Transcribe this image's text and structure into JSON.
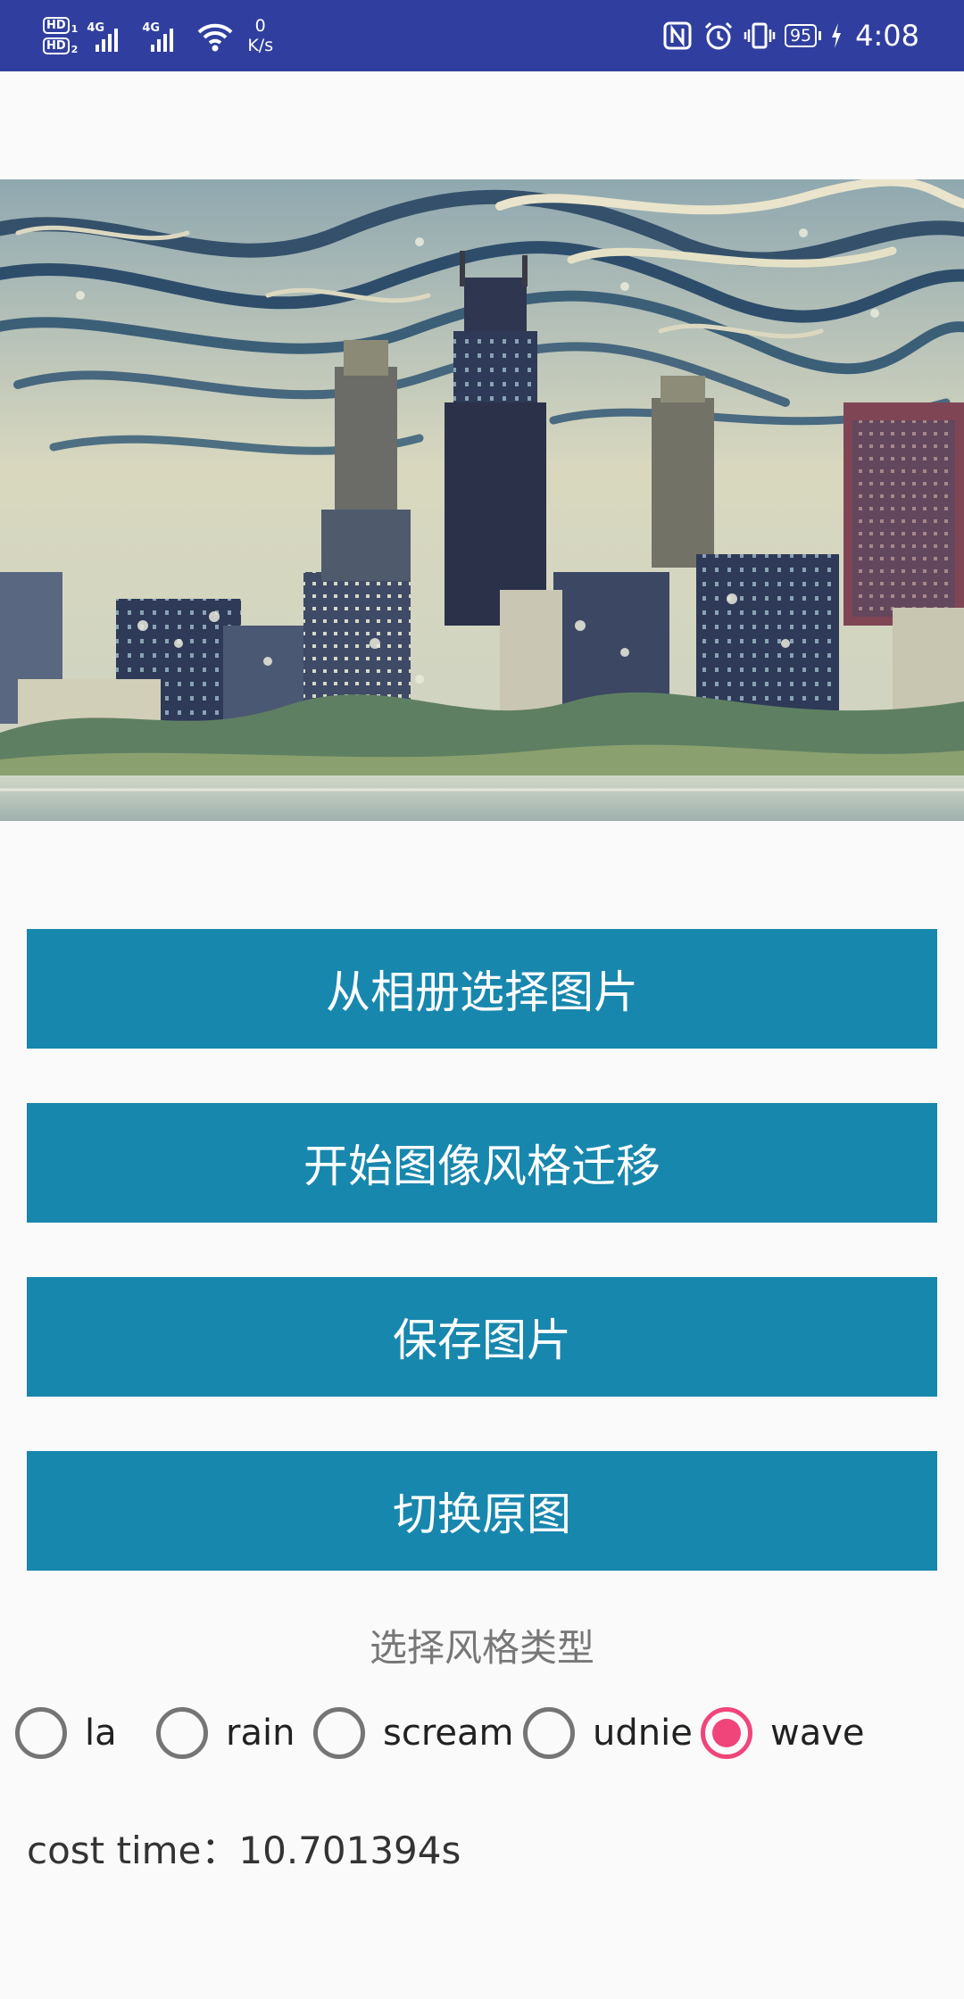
{
  "status_bar": {
    "hd1_label": "HD",
    "hd1_sub": "1",
    "hd2_label": "HD",
    "hd2_sub": "2",
    "sig1_tag": "4G",
    "sig2_tag": "4G",
    "net_speed_value": "0",
    "net_speed_unit": "K/s",
    "battery_level": "95",
    "time": "4:08",
    "icons": [
      "hd-icon",
      "signal-icon",
      "wifi-icon",
      "nfc-icon",
      "alarm-icon",
      "vibrate-icon",
      "battery-icon",
      "charging-icon"
    ]
  },
  "buttons": {
    "choose_from_album": "从相册选择图片",
    "start_style_transfer": "开始图像风格迁移",
    "save_image": "保存图片",
    "toggle_original": "切换原图"
  },
  "style_select": {
    "label": "选择风格类型",
    "options": [
      {
        "label": "la",
        "checked": false
      },
      {
        "label": "rain",
        "checked": false
      },
      {
        "label": "scream",
        "checked": false
      },
      {
        "label": "udnie",
        "checked": false
      },
      {
        "label": "wave",
        "checked": true
      }
    ]
  },
  "cost_time": "cost time：10.701394s",
  "colors": {
    "status_bar": "#303f9f",
    "button": "#1887ad",
    "radio_checked": "#f0457a",
    "radio_unchecked": "#757575",
    "background": "#fafafa"
  }
}
